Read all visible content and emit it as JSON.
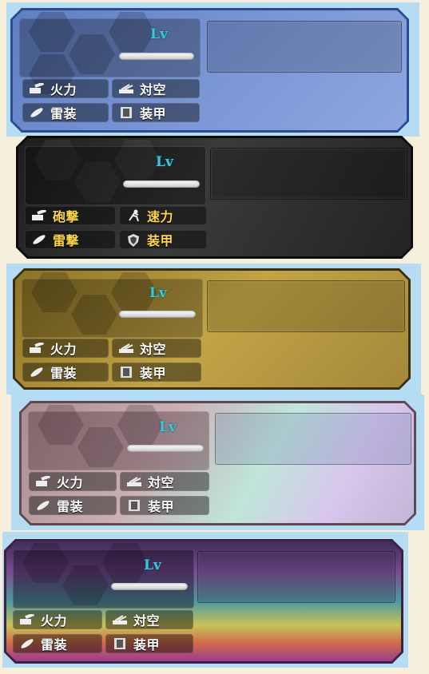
{
  "level_label": "Lv",
  "cards": [
    {
      "theme": "blue",
      "stats": [
        "火力",
        "対空",
        "雷装",
        "装甲"
      ],
      "icons": [
        "firepower-icon",
        "anti-air-icon",
        "torpedo-icon",
        "armor-icon"
      ]
    },
    {
      "theme": "black",
      "stats": [
        "砲撃",
        "速力",
        "雷撃",
        "装甲"
      ],
      "icons": [
        "firepower-icon",
        "speed-icon",
        "torpedo-icon",
        "armor-shield-icon"
      ]
    },
    {
      "theme": "gold",
      "stats": [
        "火力",
        "対空",
        "雷装",
        "装甲"
      ],
      "icons": [
        "firepower-icon",
        "anti-air-icon",
        "torpedo-icon",
        "armor-icon"
      ]
    },
    {
      "theme": "holo",
      "stats": [
        "火力",
        "対空",
        "雷装",
        "装甲"
      ],
      "icons": [
        "firepower-icon",
        "anti-air-icon",
        "torpedo-icon",
        "armor-icon"
      ]
    },
    {
      "theme": "rainbow",
      "stats": [
        "火力",
        "対空",
        "雷装",
        "装甲"
      ],
      "icons": [
        "firepower-icon",
        "anti-air-icon",
        "torpedo-icon",
        "armor-icon"
      ]
    }
  ],
  "colors": {
    "blue": "#6a86c8",
    "black": "#2a2a2a",
    "gold": "#b89a3c",
    "holo": "#c7a9b8",
    "rainbow": "#7a4f8e",
    "lv_text": "#38c8d8",
    "gold_label": "#ffd54a"
  }
}
